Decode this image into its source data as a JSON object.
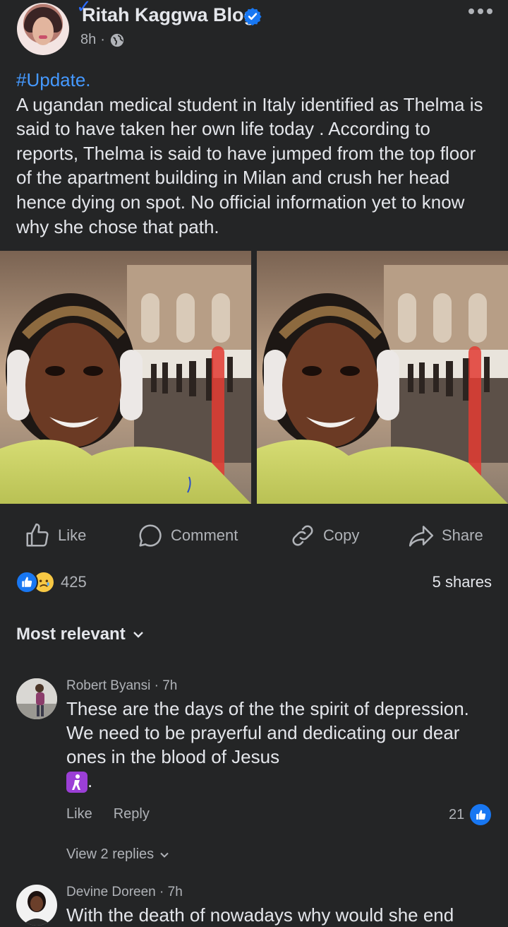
{
  "post": {
    "author": "Ritah Kaggwa Blog",
    "time": "8h",
    "separator": "·",
    "hashtag": "#Update.",
    "body": "A ugandan medical student  in Italy identified as Thelma is said to have taken her own life today . According to reports, Thelma is said to have jumped from the top floor of the apartment building in Milan and crush her head hence dying on spot. No official information yet to know why she chose that path."
  },
  "actions": [
    {
      "label": "Like",
      "icon": "thumbs-up-icon"
    },
    {
      "label": "Comment",
      "icon": "comment-bubble-icon"
    },
    {
      "label": "Copy",
      "icon": "link-icon"
    },
    {
      "label": "Share",
      "icon": "share-arrow-icon"
    }
  ],
  "stats": {
    "reaction_count": "425",
    "shares": "5 shares"
  },
  "sort": {
    "label": "Most relevant"
  },
  "comments": [
    {
      "name": "Robert Byansi",
      "time": "7h",
      "text": "These are the days of the the spirit of depression. We need to be prayerful and dedicating our dear ones in the blood of Jesus",
      "emoji_suffix": ".",
      "like_label": "Like",
      "reply_label": "Reply",
      "likes": "21",
      "view_replies": "View 2 replies"
    },
    {
      "name": "Devine Doreen",
      "time": "7h",
      "text": "With the death of nowadays why would she end"
    }
  ],
  "colors": {
    "background": "#242526",
    "primary_text": "#e4e6eb",
    "secondary_text": "#b0b3b8",
    "link_blue": "#4599ff",
    "like_blue": "#1877f2"
  }
}
